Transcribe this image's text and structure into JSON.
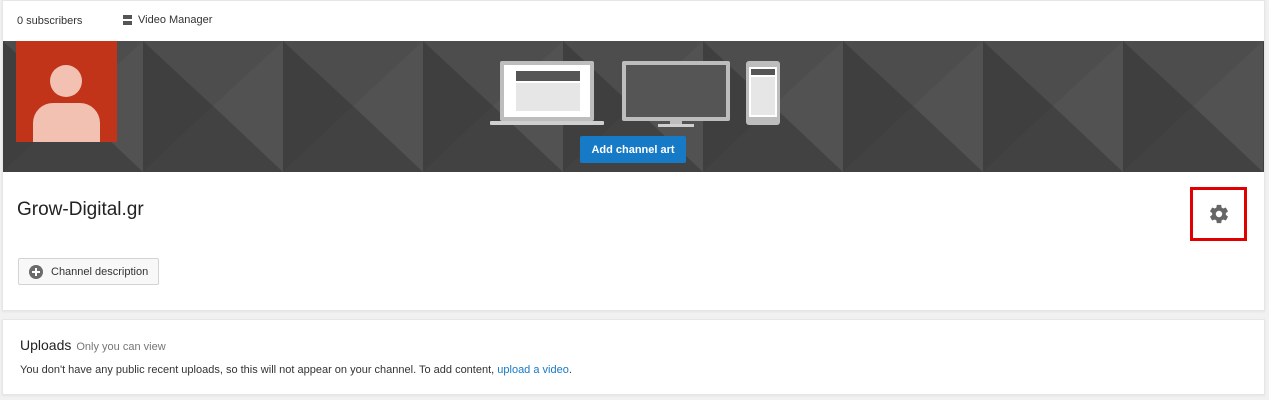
{
  "header": {
    "subscribers": "0 subscribers",
    "video_manager": "Video Manager",
    "video_manager_icon": "video-manager-icon"
  },
  "banner": {
    "add_art_label": "Add channel art",
    "avatar_icon": "default-avatar-icon",
    "devices_icon": "devices-preview-icon"
  },
  "channel": {
    "name": "Grow-Digital.gr",
    "settings_icon": "gear-icon",
    "description_button": "Channel description",
    "description_icon": "plus-circle-icon"
  },
  "uploads": {
    "title": "Uploads",
    "visibility": "Only you can view",
    "message": "You don't have any public recent uploads, so this will not appear on your channel. To add content,",
    "link": "upload a video",
    "suffix": "."
  },
  "colors": {
    "accent": "#167ac6",
    "avatar_bg": "#c1341a",
    "highlight": "#e00000",
    "banner_bg": "#4a4a4a"
  }
}
